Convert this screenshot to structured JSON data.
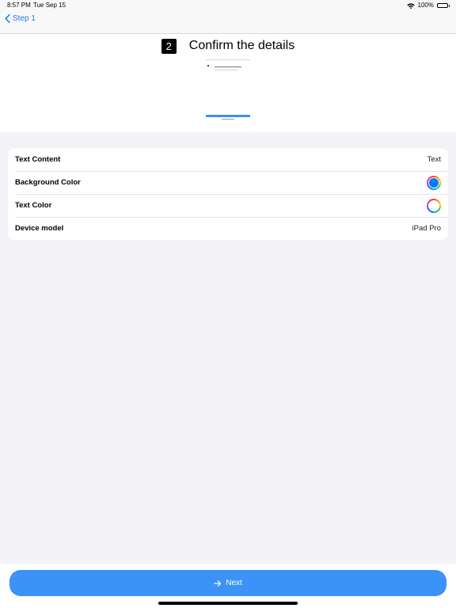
{
  "status_bar": {
    "time": "8:57 PM",
    "date": "Tue Sep 15",
    "battery": "100%",
    "wifi_icon": "wifi-icon",
    "battery_icon": "battery-icon"
  },
  "nav": {
    "back_label": "Step 1",
    "back_icon": "chevron-left-icon"
  },
  "header": {
    "step_number": "2",
    "title": "Confirm the details"
  },
  "settings": {
    "rows": [
      {
        "label": "Text Content",
        "value": "Text",
        "kind": "text"
      },
      {
        "label": "Background Color",
        "kind": "color",
        "color": "#007aff"
      },
      {
        "label": "Text Color",
        "kind": "color",
        "color": "#ffffff"
      },
      {
        "label": "Device model",
        "value": "iPad Pro",
        "kind": "text"
      }
    ]
  },
  "footer": {
    "next_label": "Next",
    "next_icon": "arrow-right-icon",
    "accent": "#3b93f7"
  }
}
